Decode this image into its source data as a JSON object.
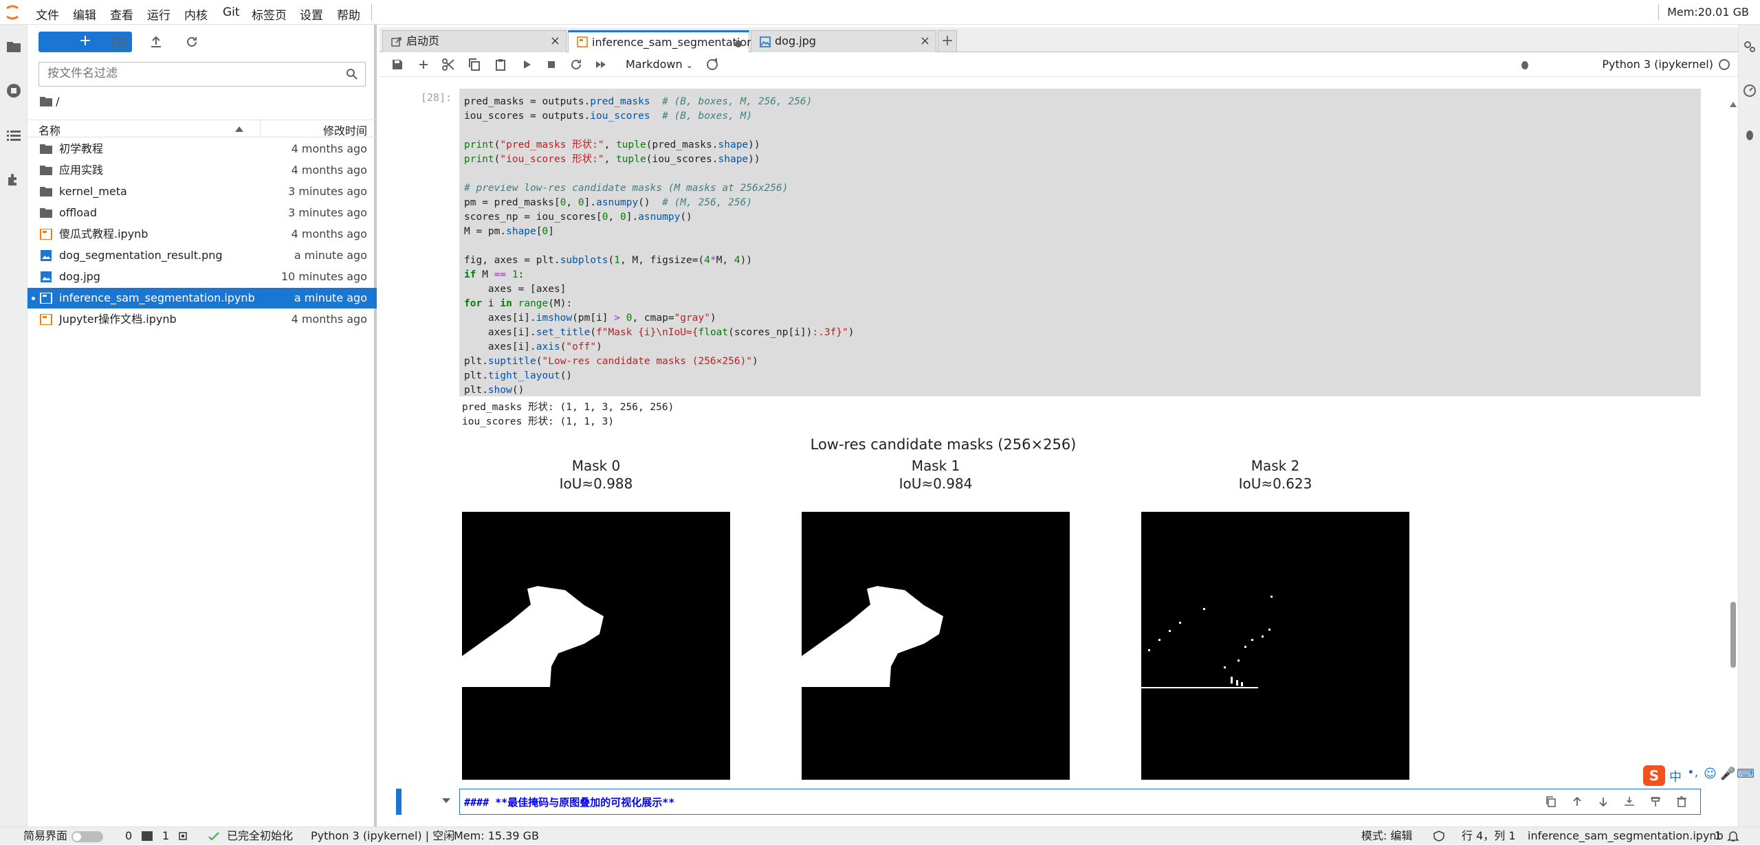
{
  "menubar": {
    "items": [
      "文件",
      "编辑",
      "查看",
      "运行",
      "内核",
      "Git",
      "标签页",
      "设置",
      "帮助"
    ],
    "mem": "Mem:20.01 GB"
  },
  "filebrowser": {
    "new_label": "+",
    "filter_placeholder": "按文件名过滤",
    "breadcrumb": "/",
    "col_name": "名称",
    "col_modified": "修改时间",
    "files": [
      {
        "name": "初学教程",
        "modified": "4 months ago",
        "type": "folder"
      },
      {
        "name": "应用实践",
        "modified": "4 months ago",
        "type": "folder"
      },
      {
        "name": "kernel_meta",
        "modified": "3 minutes ago",
        "type": "folder"
      },
      {
        "name": "offload",
        "modified": "3 minutes ago",
        "type": "folder"
      },
      {
        "name": "傻瓜式教程.ipynb",
        "modified": "4 months ago",
        "type": "notebook"
      },
      {
        "name": "dog_segmentation_result.png",
        "modified": "a minute ago",
        "type": "image"
      },
      {
        "name": "dog.jpg",
        "modified": "10 minutes ago",
        "type": "image"
      },
      {
        "name": "inference_sam_segmentation.ipynb",
        "modified": "a minute ago",
        "type": "notebook",
        "selected": true
      },
      {
        "name": "Jupyter操作文档.ipynb",
        "modified": "4 months ago",
        "type": "notebook"
      }
    ]
  },
  "tabs": [
    {
      "label": "启动页"
    },
    {
      "label": "inference_sam_segmentation"
    },
    {
      "label": "dog.jpg"
    }
  ],
  "toolbar": {
    "cell_type": "Markdown",
    "kernel": "Python 3 (ipykernel)"
  },
  "cell": {
    "prompt": "[28]:",
    "output_lines": [
      "pred_masks 形状: (1, 1, 3, 256, 256)",
      "iou_scores 形状: (1, 1, 3)"
    ]
  },
  "figure": {
    "suptitle": "Low-res candidate masks (256×256)",
    "panels": [
      {
        "title": "Mask 0",
        "iou": "IoU≈0.988"
      },
      {
        "title": "Mask 1",
        "iou": "IoU≈0.984"
      },
      {
        "title": "Mask 2",
        "iou": "IoU≈0.623"
      }
    ]
  },
  "markdown_cell": {
    "text": "#### **最佳掩码与原图叠加的可视化展示**"
  },
  "statusbar": {
    "simple_mode": "简易界面",
    "count_a": "0",
    "count_b": "1",
    "init_status": "已完全初始化",
    "kernel_status": "Python 3 (ipykernel) | 空闲",
    "mem": "Mem: 15.39 GB",
    "mode": "模式: 编辑",
    "position": "行 4，列 1",
    "filename": "inference_sam_segmentation.ipynb",
    "notif": "1"
  }
}
